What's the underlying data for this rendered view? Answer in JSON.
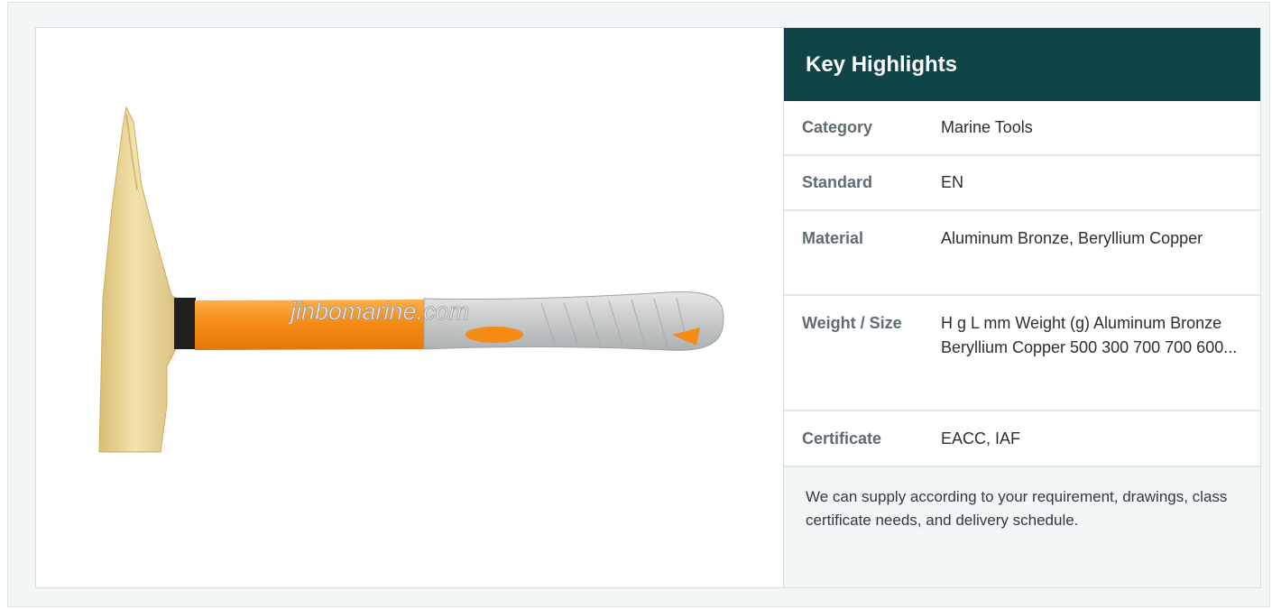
{
  "product_image": {
    "watermark": "jinbomarine.com"
  },
  "highlights": {
    "title": "Key Highlights",
    "rows": [
      {
        "label": "Category",
        "value": "Marine Tools"
      },
      {
        "label": "Standard",
        "value": "EN"
      },
      {
        "label": "Material",
        "value": "Aluminum Bronze, Beryllium Copper"
      },
      {
        "label": "Weight / Size",
        "value": "H g L mm Weight (g) Aluminum Bronze Beryllium Copper 500 300 700 700 600..."
      },
      {
        "label": "Certificate",
        "value": "EACC, IAF"
      }
    ],
    "note": "We can supply according to your requirement, drawings, class certificate needs, and delivery schedule."
  },
  "colors": {
    "header_bg": "#0f4547",
    "page_bg": "#f2f6f7",
    "handle_orange": "#f7931e",
    "grip_gray": "#c9cbcc",
    "head_brass": "#e8d190"
  }
}
